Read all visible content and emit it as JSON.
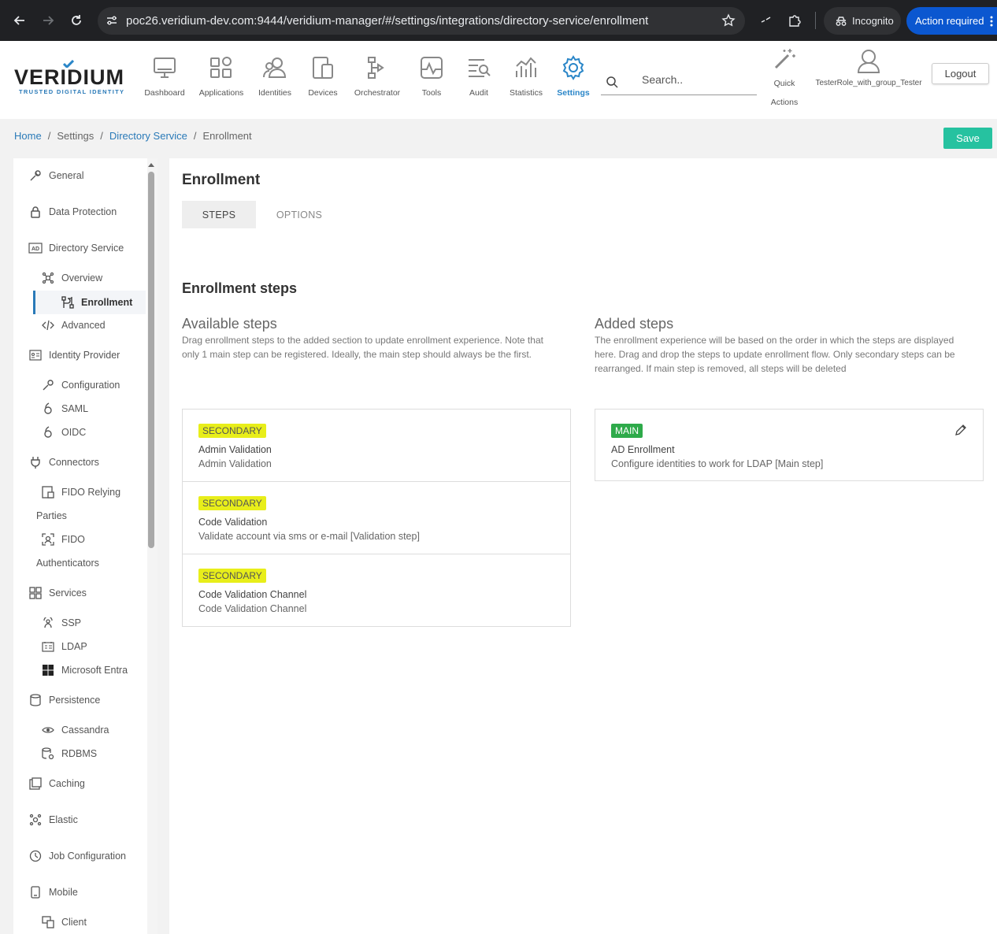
{
  "browser": {
    "url": "poc26.veridium-dev.com:9444/veridium-manager/#/settings/integrations/directory-service/enrollment",
    "incognito_label": "Incognito",
    "action_label": "Action required"
  },
  "header": {
    "logo_text": "VERIDIUM",
    "logo_tagline": "TRUSTED DIGITAL IDENTITY",
    "nav": [
      {
        "label": "Dashboard",
        "icon": "monitor-icon"
      },
      {
        "label": "Applications",
        "icon": "apps-grid-icon"
      },
      {
        "label": "Identities",
        "icon": "users-icon"
      },
      {
        "label": "Devices",
        "icon": "devices-icon"
      },
      {
        "label": "Orchestrator",
        "icon": "flow-icon"
      },
      {
        "label": "Tools",
        "icon": "pulse-icon"
      },
      {
        "label": "Audit",
        "icon": "audit-search-icon"
      },
      {
        "label": "Statistics",
        "icon": "statistics-icon"
      },
      {
        "label": "Settings",
        "icon": "gear-icon",
        "active": true
      }
    ],
    "search_placeholder": "Search..",
    "quick_actions_label": "Quick Actions",
    "user_label": "TesterRole_with_group_Tester",
    "logout_label": "Logout"
  },
  "breadcrumb": {
    "home": "Home",
    "settings": "Settings",
    "directory_service": "Directory Service",
    "current": "Enrollment"
  },
  "save_label": "Save",
  "sidebar": {
    "general": "General",
    "data_protection": "Data Protection",
    "directory_service": "Directory Service",
    "overview": "Overview",
    "enrollment": "Enrollment",
    "advanced": "Advanced",
    "identity_provider": "Identity Provider",
    "configuration": "Configuration",
    "saml": "SAML",
    "oidc": "OIDC",
    "connectors": "Connectors",
    "fido_relying_1": "FIDO Relying",
    "fido_relying_2": "Parties",
    "fido_auth_1": "FIDO",
    "fido_auth_2": "Authenticators",
    "services": "Services",
    "ssp": "SSP",
    "ldap": "LDAP",
    "microsoft_entra": "Microsoft Entra",
    "persistence": "Persistence",
    "cassandra": "Cassandra",
    "rdbms": "RDBMS",
    "caching": "Caching",
    "elastic": "Elastic",
    "job_configuration": "Job Configuration",
    "mobile": "Mobile",
    "client": "Client"
  },
  "main": {
    "title": "Enrollment",
    "tabs": [
      "STEPS",
      "OPTIONS"
    ],
    "section_title": "Enrollment steps",
    "available": {
      "title": "Available steps",
      "desc_1": "Drag enrollment steps to the added section to update enrollment experience. Note that",
      "desc_2": "only 1 main step can be registered. Ideally, the main step should always be the first.",
      "steps": [
        {
          "badge": "SECONDARY",
          "title": "Admin Validation",
          "desc": "Admin Validation"
        },
        {
          "badge": "SECONDARY",
          "title": "Code Validation",
          "desc": "Validate account via sms or e-mail [Validation step]"
        },
        {
          "badge": "SECONDARY",
          "title": "Code Validation Channel",
          "desc": "Code Validation Channel"
        }
      ]
    },
    "added": {
      "title": "Added steps",
      "desc_1": "The enrollment experience will be based on the order in which the steps are displayed",
      "desc_2": "here. Drag and drop the steps to update enrollment flow. Only secondary steps can be",
      "desc_3": "rearranged. If main step is removed, all steps will be deleted",
      "steps": [
        {
          "badge": "MAIN",
          "title": "AD Enrollment",
          "desc": "Configure identities to work for LDAP [Main step]"
        }
      ]
    }
  },
  "colors": {
    "accent": "#2a7ab8",
    "save": "#26c2a0",
    "secondary_badge": "#e8ee1a",
    "main_badge": "#2eaa4a"
  }
}
